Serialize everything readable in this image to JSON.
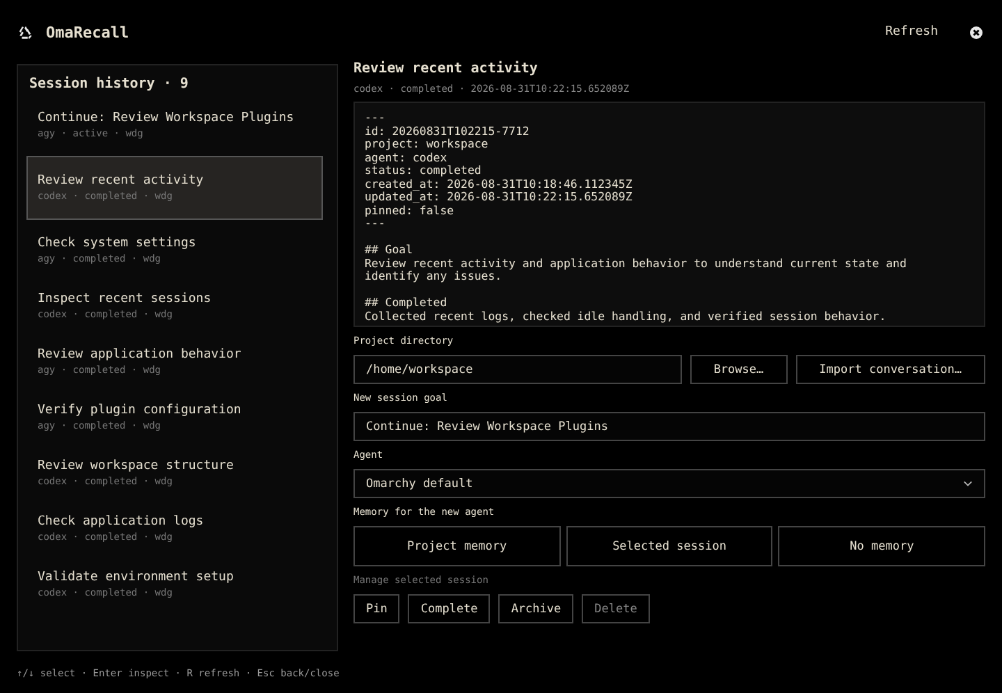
{
  "app": {
    "title": "OmaRecall",
    "refresh": "Refresh"
  },
  "history": {
    "title": "Session history · 9",
    "sessions": [
      {
        "title": "Continue: Review Workspace Plugins",
        "meta": "agy · active · wdg",
        "selected": false
      },
      {
        "title": "Review recent activity",
        "meta": "codex · completed · wdg",
        "selected": true
      },
      {
        "title": "Check system settings",
        "meta": "agy · completed · wdg",
        "selected": false
      },
      {
        "title": "Inspect recent sessions",
        "meta": "codex · completed · wdg",
        "selected": false
      },
      {
        "title": "Review application behavior",
        "meta": "agy · completed · wdg",
        "selected": false
      },
      {
        "title": "Verify plugin configuration",
        "meta": "agy · completed · wdg",
        "selected": false
      },
      {
        "title": "Review workspace structure",
        "meta": "codex · completed · wdg",
        "selected": false
      },
      {
        "title": "Check application logs",
        "meta": "codex · completed · wdg",
        "selected": false
      },
      {
        "title": "Validate environment setup",
        "meta": "codex · completed · wdg",
        "selected": false
      }
    ]
  },
  "detail": {
    "title": "Review recent activity",
    "meta": "codex · completed · 2026-08-31T10:22:15.652089Z",
    "preview": [
      [
        "---",
        "id: 20260831T102215-7712",
        "project: workspace",
        "agent: codex",
        "status: completed",
        "created_at: 2026-08-31T10:18:46.112345Z",
        "updated_at: 2026-08-31T10:22:15.652089Z",
        "pinned: false",
        "---"
      ],
      [
        "## Goal",
        "Review recent activity and application behavior to understand current state and",
        "identify any issues."
      ],
      [
        "## Completed",
        "Collected recent logs, checked idle handling, and verified session behavior."
      ]
    ]
  },
  "project_directory": {
    "label": "Project directory",
    "value": "/home/workspace",
    "buttons": [
      "Browse…",
      "Import conversation…"
    ]
  },
  "goal": {
    "label": "New session goal",
    "value": "Continue: Review Workspace Plugins"
  },
  "agent": {
    "label": "Agent",
    "value": "Omarchy default"
  },
  "memory": {
    "label": "Memory for the new agent",
    "options": [
      "Project memory",
      "Selected session",
      "No memory"
    ]
  },
  "manage": {
    "label": "Manage selected session",
    "buttons": [
      {
        "label": "Pin",
        "disabled": false
      },
      {
        "label": "Complete",
        "disabled": false
      },
      {
        "label": "Archive",
        "disabled": false
      },
      {
        "label": "Delete",
        "disabled": true
      }
    ]
  },
  "footer": "↑/↓ select · Enter inspect · R refresh · Esc back/close"
}
